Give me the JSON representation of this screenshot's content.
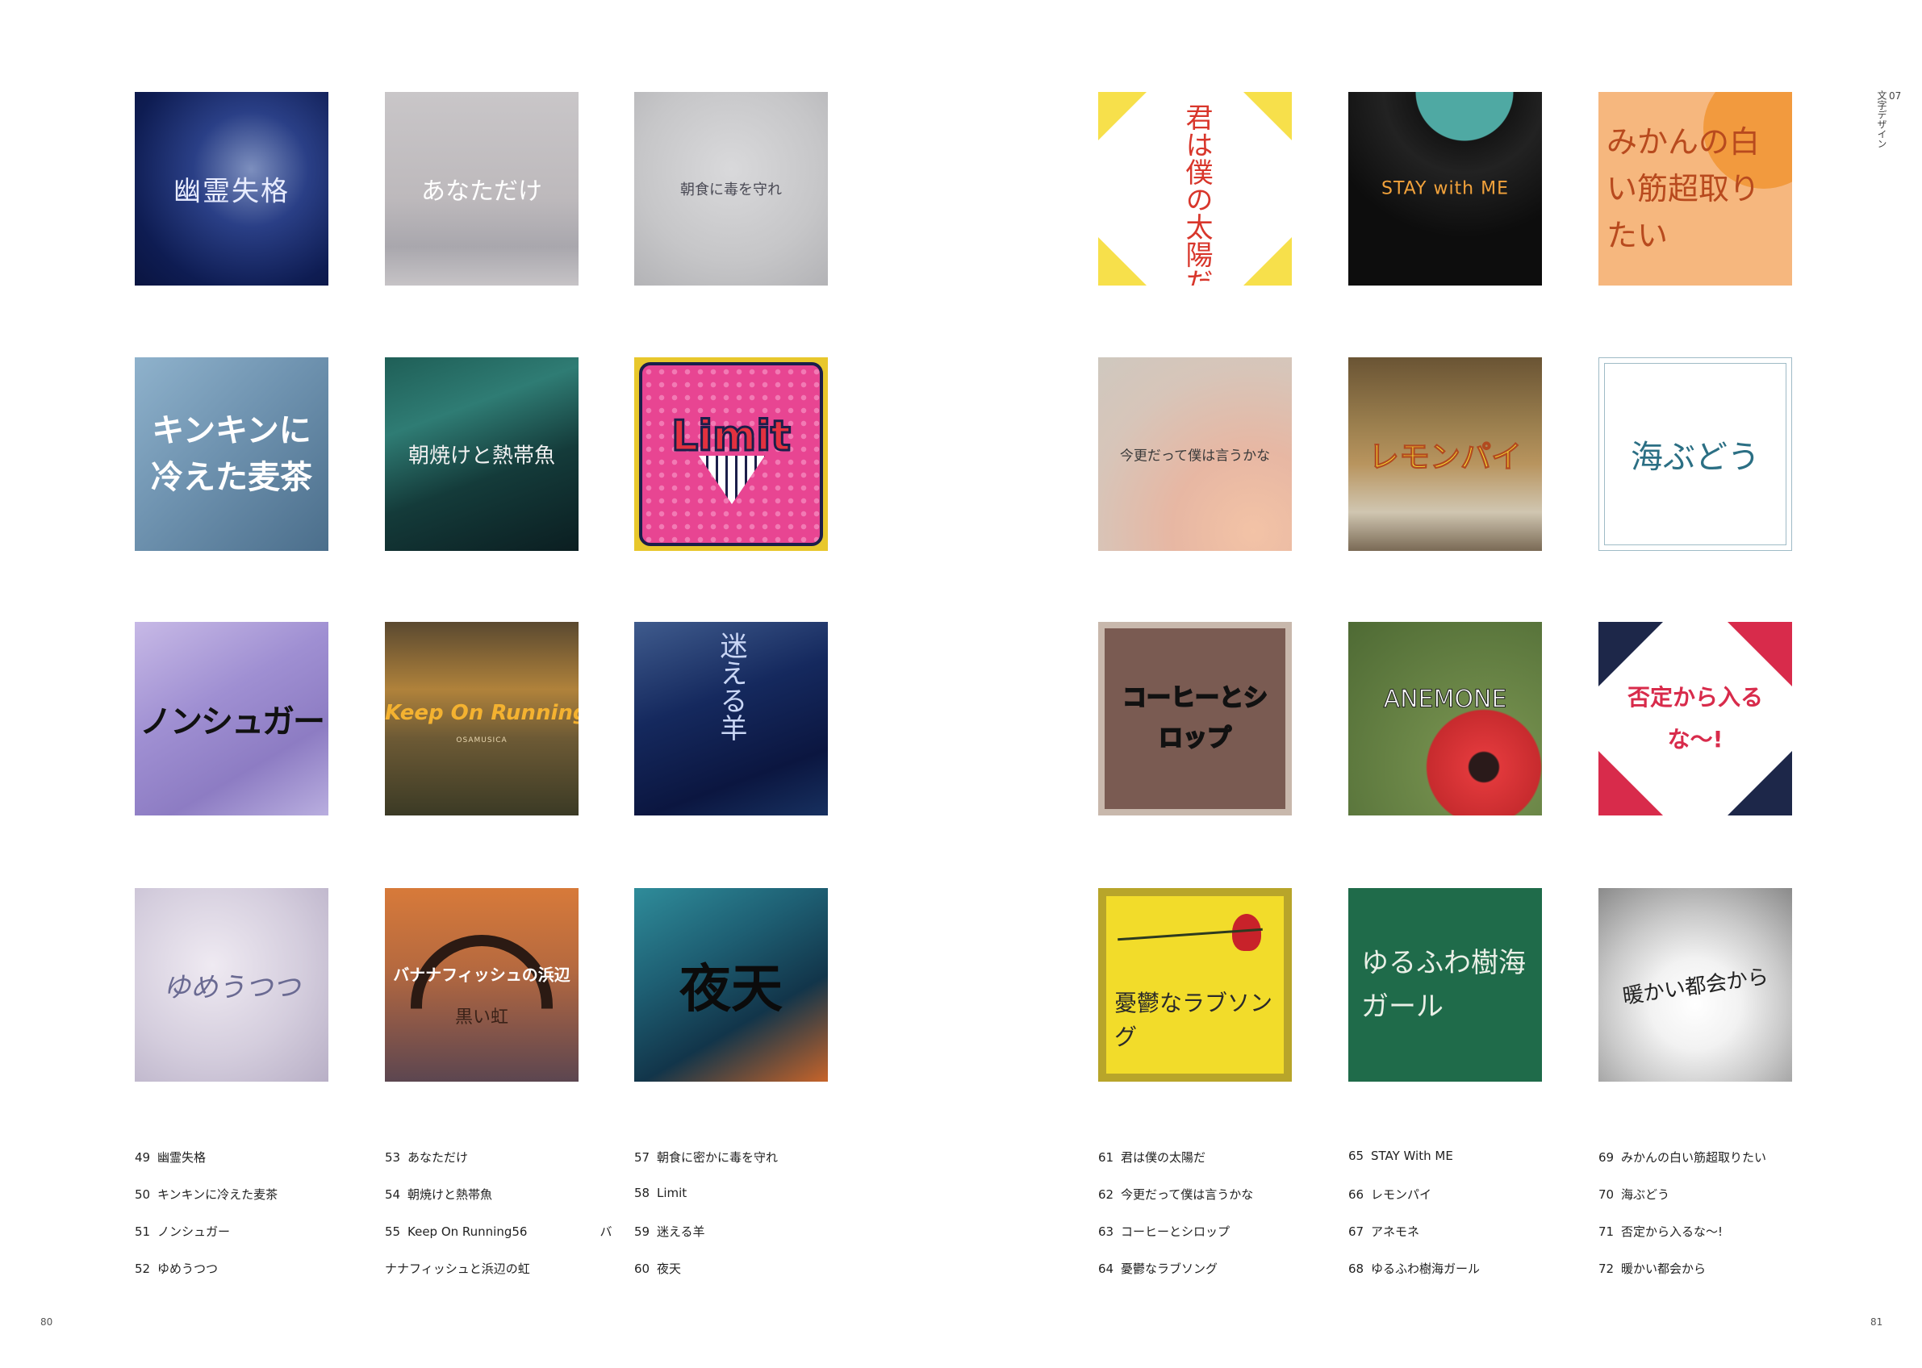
{
  "page_left": "80",
  "page_right": "81",
  "chapter": {
    "number": "07",
    "title": "文字デザイン"
  },
  "covers": [
    {
      "title": "幽霊失格"
    },
    {
      "title": "あなただけ"
    },
    {
      "title": "朝食に毒を守れ"
    },
    {
      "title": "キンキンに冷えた麦茶"
    },
    {
      "title": "朝焼けと熱帯魚"
    },
    {
      "title": "Limit"
    },
    {
      "title": "ノンシュガー"
    },
    {
      "title": "Keep On Running",
      "sub": "OSAMUSICA"
    },
    {
      "title": "迷える羊"
    },
    {
      "title": "ゆめうつつ"
    },
    {
      "title": "バナナフィッシュの浜辺",
      "sub": "黒い虹"
    },
    {
      "title": "夜天"
    },
    {
      "title": "君は僕の太陽だ!"
    },
    {
      "title": "STAY with ME"
    },
    {
      "title": "みかんの白い筋超取りたい"
    },
    {
      "title": "今更だって僕は言うかな"
    },
    {
      "title": "レモンパイ"
    },
    {
      "title": "海ぶどう"
    },
    {
      "title": "コーヒーとシロップ"
    },
    {
      "title": "ANEMONE"
    },
    {
      "title": "否定から入るな〜!"
    },
    {
      "title": "憂鬱なラブソング"
    },
    {
      "title": "ゆるふわ樹海ガール"
    },
    {
      "title": "暖かい都会から"
    }
  ],
  "captions": [
    {
      "num": "49",
      "text": "幽霊失格"
    },
    {
      "num": "50",
      "text": "キンキンに冷えた麦茶"
    },
    {
      "num": "51",
      "text": "ノンシュガー"
    },
    {
      "num": "52",
      "text": "ゆめうつつ"
    },
    {
      "num": "53",
      "text": "あなただけ"
    },
    {
      "num": "54",
      "text": "朝焼けと熱帯魚"
    },
    {
      "num": "55",
      "text": "Keep On Running56　　　　　　バ"
    },
    {
      "num": "",
      "text": "ナナフィッシュと浜辺の虹"
    },
    {
      "num": "57",
      "text": "朝食に密かに毒を守れ"
    },
    {
      "num": "58",
      "text": "Limit"
    },
    {
      "num": "59",
      "text": "迷える羊"
    },
    {
      "num": "60",
      "text": "夜天"
    },
    {
      "num": "61",
      "text": "君は僕の太陽だ"
    },
    {
      "num": "62",
      "text": "今更だって僕は言うかな"
    },
    {
      "num": "63",
      "text": "コーヒーとシロップ"
    },
    {
      "num": "64",
      "text": "憂鬱なラブソング"
    },
    {
      "num": "65",
      "text": "STAY With ME"
    },
    {
      "num": "66",
      "text": "レモンパイ"
    },
    {
      "num": "67",
      "text": "アネモネ"
    },
    {
      "num": "68",
      "text": "ゆるふわ樹海ガール"
    },
    {
      "num": "69",
      "text": "みかんの白い筋超取りたい"
    },
    {
      "num": "70",
      "text": "海ぶどう"
    },
    {
      "num": "71",
      "text": "否定から入るな〜!"
    },
    {
      "num": "72",
      "text": "暖かい都会から"
    }
  ]
}
